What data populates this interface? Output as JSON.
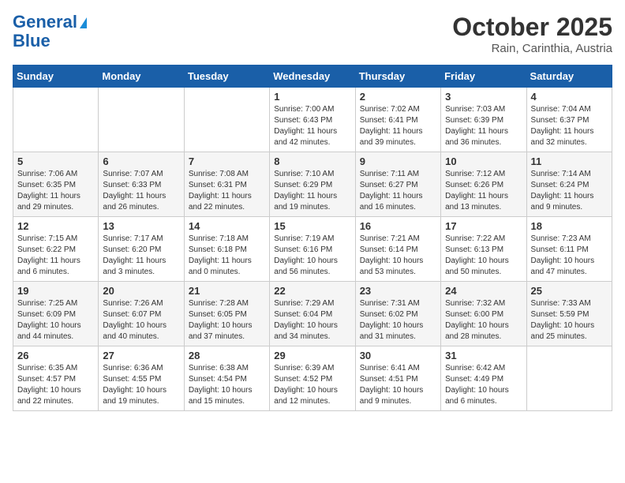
{
  "header": {
    "logo_line1": "General",
    "logo_line2": "Blue",
    "month_title": "October 2025",
    "subtitle": "Rain, Carinthia, Austria"
  },
  "days_of_week": [
    "Sunday",
    "Monday",
    "Tuesday",
    "Wednesday",
    "Thursday",
    "Friday",
    "Saturday"
  ],
  "weeks": [
    [
      {
        "day": "",
        "info": ""
      },
      {
        "day": "",
        "info": ""
      },
      {
        "day": "",
        "info": ""
      },
      {
        "day": "1",
        "info": "Sunrise: 7:00 AM\nSunset: 6:43 PM\nDaylight: 11 hours and 42 minutes."
      },
      {
        "day": "2",
        "info": "Sunrise: 7:02 AM\nSunset: 6:41 PM\nDaylight: 11 hours and 39 minutes."
      },
      {
        "day": "3",
        "info": "Sunrise: 7:03 AM\nSunset: 6:39 PM\nDaylight: 11 hours and 36 minutes."
      },
      {
        "day": "4",
        "info": "Sunrise: 7:04 AM\nSunset: 6:37 PM\nDaylight: 11 hours and 32 minutes."
      }
    ],
    [
      {
        "day": "5",
        "info": "Sunrise: 7:06 AM\nSunset: 6:35 PM\nDaylight: 11 hours and 29 minutes."
      },
      {
        "day": "6",
        "info": "Sunrise: 7:07 AM\nSunset: 6:33 PM\nDaylight: 11 hours and 26 minutes."
      },
      {
        "day": "7",
        "info": "Sunrise: 7:08 AM\nSunset: 6:31 PM\nDaylight: 11 hours and 22 minutes."
      },
      {
        "day": "8",
        "info": "Sunrise: 7:10 AM\nSunset: 6:29 PM\nDaylight: 11 hours and 19 minutes."
      },
      {
        "day": "9",
        "info": "Sunrise: 7:11 AM\nSunset: 6:27 PM\nDaylight: 11 hours and 16 minutes."
      },
      {
        "day": "10",
        "info": "Sunrise: 7:12 AM\nSunset: 6:26 PM\nDaylight: 11 hours and 13 minutes."
      },
      {
        "day": "11",
        "info": "Sunrise: 7:14 AM\nSunset: 6:24 PM\nDaylight: 11 hours and 9 minutes."
      }
    ],
    [
      {
        "day": "12",
        "info": "Sunrise: 7:15 AM\nSunset: 6:22 PM\nDaylight: 11 hours and 6 minutes."
      },
      {
        "day": "13",
        "info": "Sunrise: 7:17 AM\nSunset: 6:20 PM\nDaylight: 11 hours and 3 minutes."
      },
      {
        "day": "14",
        "info": "Sunrise: 7:18 AM\nSunset: 6:18 PM\nDaylight: 11 hours and 0 minutes."
      },
      {
        "day": "15",
        "info": "Sunrise: 7:19 AM\nSunset: 6:16 PM\nDaylight: 10 hours and 56 minutes."
      },
      {
        "day": "16",
        "info": "Sunrise: 7:21 AM\nSunset: 6:14 PM\nDaylight: 10 hours and 53 minutes."
      },
      {
        "day": "17",
        "info": "Sunrise: 7:22 AM\nSunset: 6:13 PM\nDaylight: 10 hours and 50 minutes."
      },
      {
        "day": "18",
        "info": "Sunrise: 7:23 AM\nSunset: 6:11 PM\nDaylight: 10 hours and 47 minutes."
      }
    ],
    [
      {
        "day": "19",
        "info": "Sunrise: 7:25 AM\nSunset: 6:09 PM\nDaylight: 10 hours and 44 minutes."
      },
      {
        "day": "20",
        "info": "Sunrise: 7:26 AM\nSunset: 6:07 PM\nDaylight: 10 hours and 40 minutes."
      },
      {
        "day": "21",
        "info": "Sunrise: 7:28 AM\nSunset: 6:05 PM\nDaylight: 10 hours and 37 minutes."
      },
      {
        "day": "22",
        "info": "Sunrise: 7:29 AM\nSunset: 6:04 PM\nDaylight: 10 hours and 34 minutes."
      },
      {
        "day": "23",
        "info": "Sunrise: 7:31 AM\nSunset: 6:02 PM\nDaylight: 10 hours and 31 minutes."
      },
      {
        "day": "24",
        "info": "Sunrise: 7:32 AM\nSunset: 6:00 PM\nDaylight: 10 hours and 28 minutes."
      },
      {
        "day": "25",
        "info": "Sunrise: 7:33 AM\nSunset: 5:59 PM\nDaylight: 10 hours and 25 minutes."
      }
    ],
    [
      {
        "day": "26",
        "info": "Sunrise: 6:35 AM\nSunset: 4:57 PM\nDaylight: 10 hours and 22 minutes."
      },
      {
        "day": "27",
        "info": "Sunrise: 6:36 AM\nSunset: 4:55 PM\nDaylight: 10 hours and 19 minutes."
      },
      {
        "day": "28",
        "info": "Sunrise: 6:38 AM\nSunset: 4:54 PM\nDaylight: 10 hours and 15 minutes."
      },
      {
        "day": "29",
        "info": "Sunrise: 6:39 AM\nSunset: 4:52 PM\nDaylight: 10 hours and 12 minutes."
      },
      {
        "day": "30",
        "info": "Sunrise: 6:41 AM\nSunset: 4:51 PM\nDaylight: 10 hours and 9 minutes."
      },
      {
        "day": "31",
        "info": "Sunrise: 6:42 AM\nSunset: 4:49 PM\nDaylight: 10 hours and 6 minutes."
      },
      {
        "day": "",
        "info": ""
      }
    ]
  ]
}
